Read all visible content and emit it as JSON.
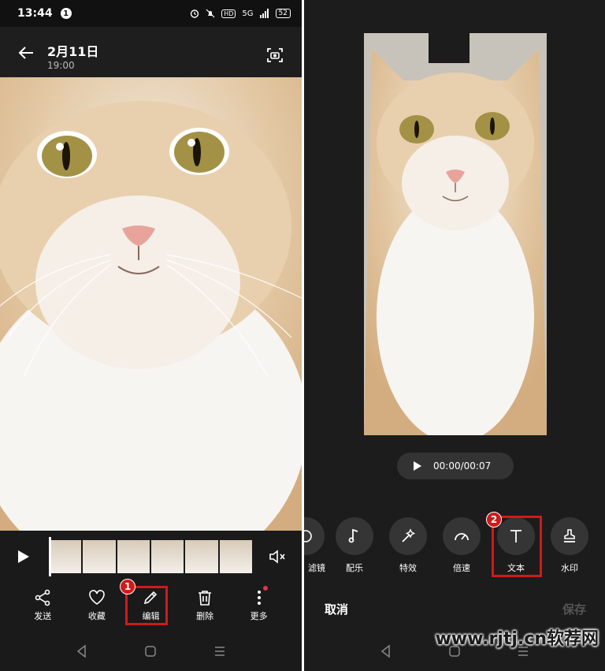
{
  "left": {
    "status": {
      "time": "13:44",
      "notif_badge": "1",
      "hd": "HD",
      "signal": "5G",
      "battery": "52"
    },
    "header": {
      "title": "2月11日",
      "subtitle": "19:00"
    },
    "actions": [
      {
        "icon": "share-icon",
        "label": "发送"
      },
      {
        "icon": "heart-icon",
        "label": "收藏"
      },
      {
        "icon": "pencil-icon",
        "label": "编辑"
      },
      {
        "icon": "trash-icon",
        "label": "删除"
      },
      {
        "icon": "more-icon",
        "label": "更多"
      }
    ],
    "step_badge": "1"
  },
  "right": {
    "time_display": "00:00/00:07",
    "tools": [
      {
        "icon": "filter-icon",
        "label": "滤镜"
      },
      {
        "icon": "music-note-icon",
        "label": "配乐"
      },
      {
        "icon": "magic-wand-icon",
        "label": "特效"
      },
      {
        "icon": "speedometer-icon",
        "label": "倍速"
      },
      {
        "icon": "text-t-icon",
        "label": "文本"
      },
      {
        "icon": "stamp-icon",
        "label": "水印"
      }
    ],
    "cancel_label": "取消",
    "save_label": "保存",
    "step_badge": "2"
  },
  "watermark": "www.rjtj.cn软荐网",
  "colors": {
    "highlight": "#d01a1a",
    "background": "#1c1c1c"
  }
}
